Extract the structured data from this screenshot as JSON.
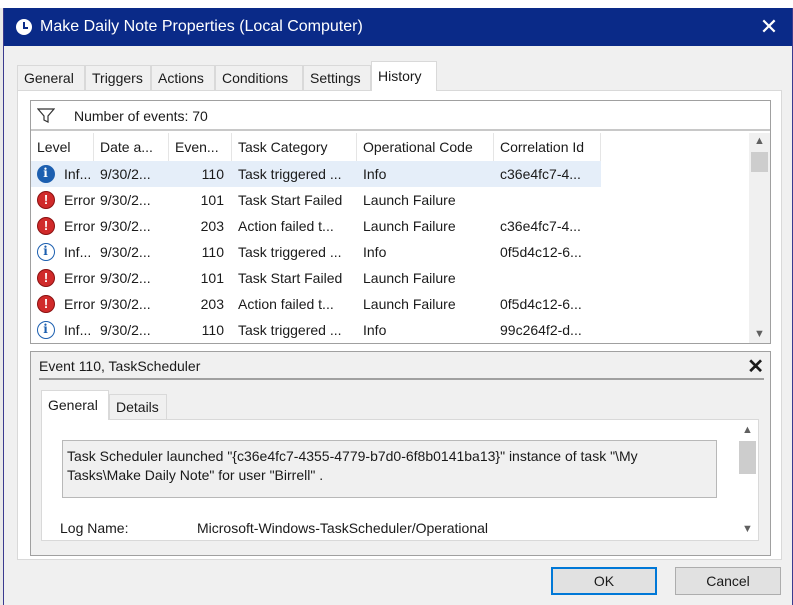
{
  "window": {
    "title": "Make Daily Note Properties (Local Computer)",
    "close_glyph": "✕"
  },
  "tabs": [
    {
      "label": "General"
    },
    {
      "label": "Triggers"
    },
    {
      "label": "Actions"
    },
    {
      "label": "Conditions"
    },
    {
      "label": "Settings"
    },
    {
      "label": "History",
      "active": true
    }
  ],
  "history": {
    "filter_icon": "filter-icon",
    "event_count_text": "Number of events: 70",
    "columns": [
      "Level",
      "Date a...",
      "Even...",
      "Task Category",
      "Operational Code",
      "Correlation Id"
    ],
    "rows": [
      {
        "level_icon": "info",
        "level": "Inf...",
        "date": "9/30/2...",
        "event": "110",
        "category": "Task triggered ...",
        "opcode": "Info",
        "correlation": "c36e4fc7-4...",
        "selected": true
      },
      {
        "level_icon": "error",
        "level": "Error",
        "date": "9/30/2...",
        "event": "101",
        "category": "Task Start Failed",
        "opcode": "Launch Failure",
        "correlation": ""
      },
      {
        "level_icon": "error",
        "level": "Error",
        "date": "9/30/2...",
        "event": "203",
        "category": "Action failed t...",
        "opcode": "Launch Failure",
        "correlation": "c36e4fc7-4..."
      },
      {
        "level_icon": "info",
        "level": "Inf...",
        "date": "9/30/2...",
        "event": "110",
        "category": "Task triggered ...",
        "opcode": "Info",
        "correlation": "0f5d4c12-6..."
      },
      {
        "level_icon": "error",
        "level": "Error",
        "date": "9/30/2...",
        "event": "101",
        "category": "Task Start Failed",
        "opcode": "Launch Failure",
        "correlation": ""
      },
      {
        "level_icon": "error",
        "level": "Error",
        "date": "9/30/2...",
        "event": "203",
        "category": "Action failed t...",
        "opcode": "Launch Failure",
        "correlation": "0f5d4c12-6..."
      },
      {
        "level_icon": "info",
        "level": "Inf...",
        "date": "9/30/2...",
        "event": "110",
        "category": "Task triggered ...",
        "opcode": "Info",
        "correlation": "99c264f2-d..."
      }
    ]
  },
  "detail": {
    "title": "Event 110, TaskScheduler",
    "close_glyph": "✕",
    "tabs": [
      {
        "label": "General",
        "active": true
      },
      {
        "label": "Details"
      }
    ],
    "message": "Task Scheduler launched \"{c36e4fc7-4355-4779-b7d0-6f8b0141ba13}\"  instance of task \"\\My Tasks\\Make Daily Note\"  for user \"Birrell\" .",
    "log_name_label": "Log Name:",
    "log_name_value": "Microsoft-Windows-TaskScheduler/Operational"
  },
  "buttons": {
    "ok": "OK",
    "cancel": "Cancel"
  },
  "colors": {
    "titlebar": "#0a2a88",
    "selected_row": "#e5eef9",
    "error_icon": "#d02a2a",
    "info_icon": "#1c5fb0",
    "primary_button_border": "#0078d7"
  }
}
